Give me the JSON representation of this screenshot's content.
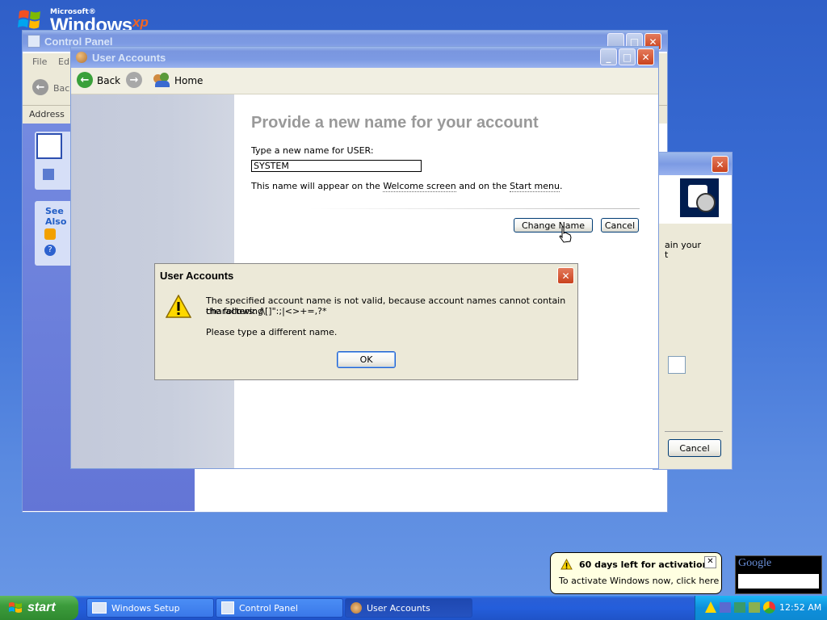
{
  "desktop": {
    "logo": {
      "brand": "Microsoft®",
      "product": "Windows",
      "edition": "xp"
    }
  },
  "control_panel": {
    "title": "Control Panel",
    "menu": [
      "File",
      "Edit"
    ],
    "back_label": "Back",
    "address_label": "Address",
    "see_also": "See Also"
  },
  "setup_dialog": {
    "text_line1": "ain your",
    "text_line2": "t",
    "cancel_label": "Cancel"
  },
  "user_accounts": {
    "title": "User Accounts",
    "toolbar": {
      "back_label": "Back",
      "home_label": "Home"
    },
    "heading": "Provide a new name for your account",
    "field_label": "Type a new name for USER:",
    "field_value": "SYSTEM",
    "hint_prefix": "This name will appear on the ",
    "hint_link1": "Welcome screen",
    "hint_middle": " and on the ",
    "hint_link2": "Start menu",
    "hint_suffix": ".",
    "change_name_label": "Change Name",
    "cancel_label": "Cancel"
  },
  "error_dialog": {
    "title": "User Accounts",
    "message_line1": "The specified account name is not valid, because account names cannot contain the following",
    "message_line2": "characters: /\\[]\":;|<>+=,?*",
    "message_line3": "Please type a different name.",
    "ok_label": "OK"
  },
  "taskbar": {
    "start_label": "start",
    "tasks": [
      {
        "label": "Windows Setup"
      },
      {
        "label": "Control Panel"
      },
      {
        "label": "User Accounts"
      }
    ],
    "clock": "12:52 AM"
  },
  "balloon": {
    "title": "60 days left for activation",
    "text": "To activate Windows now, click here"
  },
  "google_widget": {
    "label": "Google"
  },
  "colors": {
    "title_active": "#0054e3",
    "title_inactive": "#7c9ae3",
    "window_face": "#ece9d8",
    "taskbar": "#245edb",
    "start_green": "#3c9c3c",
    "error_close_red": "#c9421d"
  }
}
